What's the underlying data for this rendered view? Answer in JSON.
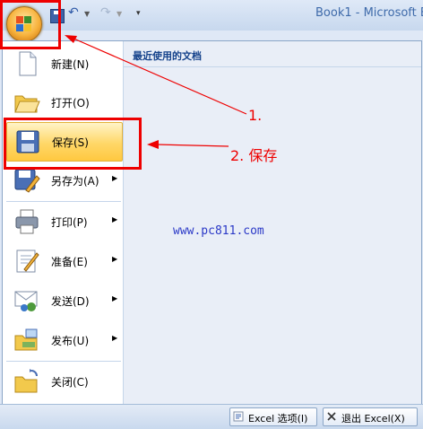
{
  "window": {
    "title": "Book1 - Microsoft E"
  },
  "quick_access": {
    "save": "save-icon",
    "undo": "undo-icon",
    "redo": "redo-icon",
    "customize": "customize-icon"
  },
  "menu": {
    "items": [
      {
        "label": "新建(N)",
        "icon": "new-document-icon"
      },
      {
        "label": "打开(O)",
        "icon": "open-folder-icon"
      },
      {
        "label": "保存(S)",
        "icon": "floppy-disk-icon",
        "highlighted": true
      },
      {
        "label": "另存为(A)",
        "icon": "save-as-icon",
        "submenu": true
      },
      {
        "label": "打印(P)",
        "icon": "printer-icon",
        "submenu": true
      },
      {
        "label": "准备(E)",
        "icon": "prepare-icon",
        "submenu": true
      },
      {
        "label": "发送(D)",
        "icon": "send-icon",
        "submenu": true
      },
      {
        "label": "发布(U)",
        "icon": "publish-icon",
        "submenu": true
      },
      {
        "label": "关闭(C)",
        "icon": "close-folder-icon"
      }
    ],
    "recent_title": "最近使用的文档"
  },
  "footer": {
    "options_label": "Excel 选项(I)",
    "exit_label": "退出 Excel(X)"
  },
  "annotations": {
    "step1": "1.",
    "step2": "2. 保存",
    "watermark": "www.pc811.com"
  },
  "colors": {
    "highlight": "#ffd767",
    "annotation": "#e00000",
    "accent": "#15428b"
  }
}
